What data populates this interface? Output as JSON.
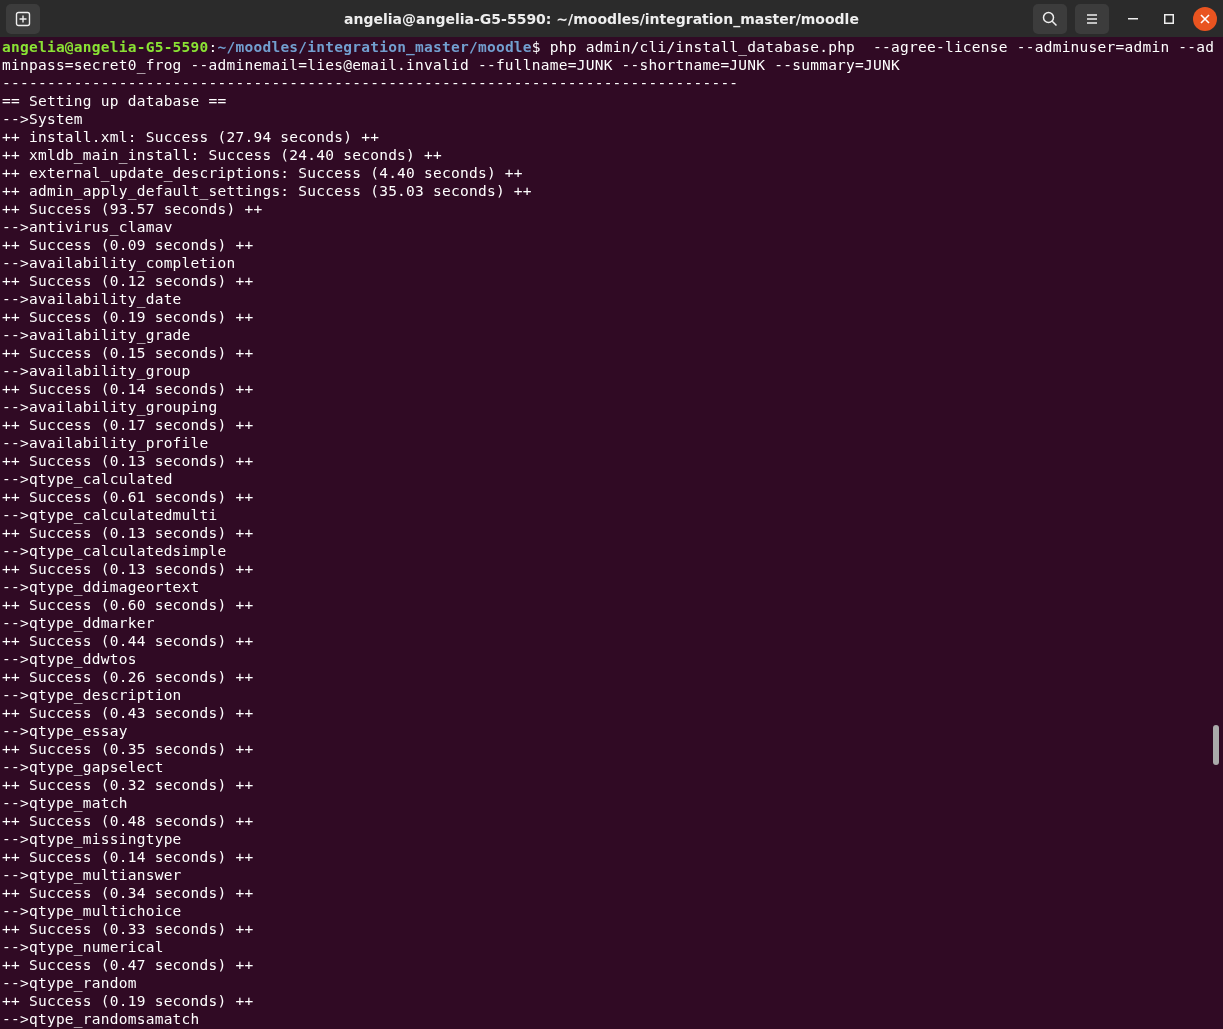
{
  "window": {
    "title": "angelia@angelia-G5-5590: ~/moodles/integration_master/moodle"
  },
  "prompt": {
    "user_host": "angelia@angelia-G5-5590",
    "separator": ":",
    "path": "~/moodles/integration_master/moodle",
    "symbol": "$",
    "command": " php admin/cli/install_database.php  --agree-license --adminuser=admin --adminpass=secret0_frog --adminemail=lies@email.invalid --fullname=JUNK --shortname=JUNK --summary=JUNK"
  },
  "output": [
    "----------------------------------------------------------------------------------",
    "== Setting up database ==",
    "-->System",
    "++ install.xml: Success (27.94 seconds) ++",
    "++ xmldb_main_install: Success (24.40 seconds) ++",
    "++ external_update_descriptions: Success (4.40 seconds) ++",
    "++ admin_apply_default_settings: Success (35.03 seconds) ++",
    "++ Success (93.57 seconds) ++",
    "-->antivirus_clamav",
    "++ Success (0.09 seconds) ++",
    "-->availability_completion",
    "++ Success (0.12 seconds) ++",
    "-->availability_date",
    "++ Success (0.19 seconds) ++",
    "-->availability_grade",
    "++ Success (0.15 seconds) ++",
    "-->availability_group",
    "++ Success (0.14 seconds) ++",
    "-->availability_grouping",
    "++ Success (0.17 seconds) ++",
    "-->availability_profile",
    "++ Success (0.13 seconds) ++",
    "-->qtype_calculated",
    "++ Success (0.61 seconds) ++",
    "-->qtype_calculatedmulti",
    "++ Success (0.13 seconds) ++",
    "-->qtype_calculatedsimple",
    "++ Success (0.13 seconds) ++",
    "-->qtype_ddimageortext",
    "++ Success (0.60 seconds) ++",
    "-->qtype_ddmarker",
    "++ Success (0.44 seconds) ++",
    "-->qtype_ddwtos",
    "++ Success (0.26 seconds) ++",
    "-->qtype_description",
    "++ Success (0.43 seconds) ++",
    "-->qtype_essay",
    "++ Success (0.35 seconds) ++",
    "-->qtype_gapselect",
    "++ Success (0.32 seconds) ++",
    "-->qtype_match",
    "++ Success (0.48 seconds) ++",
    "-->qtype_missingtype",
    "++ Success (0.14 seconds) ++",
    "-->qtype_multianswer",
    "++ Success (0.34 seconds) ++",
    "-->qtype_multichoice",
    "++ Success (0.33 seconds) ++",
    "-->qtype_numerical",
    "++ Success (0.47 seconds) ++",
    "-->qtype_random",
    "++ Success (0.19 seconds) ++",
    "-->qtype_randomsamatch"
  ]
}
